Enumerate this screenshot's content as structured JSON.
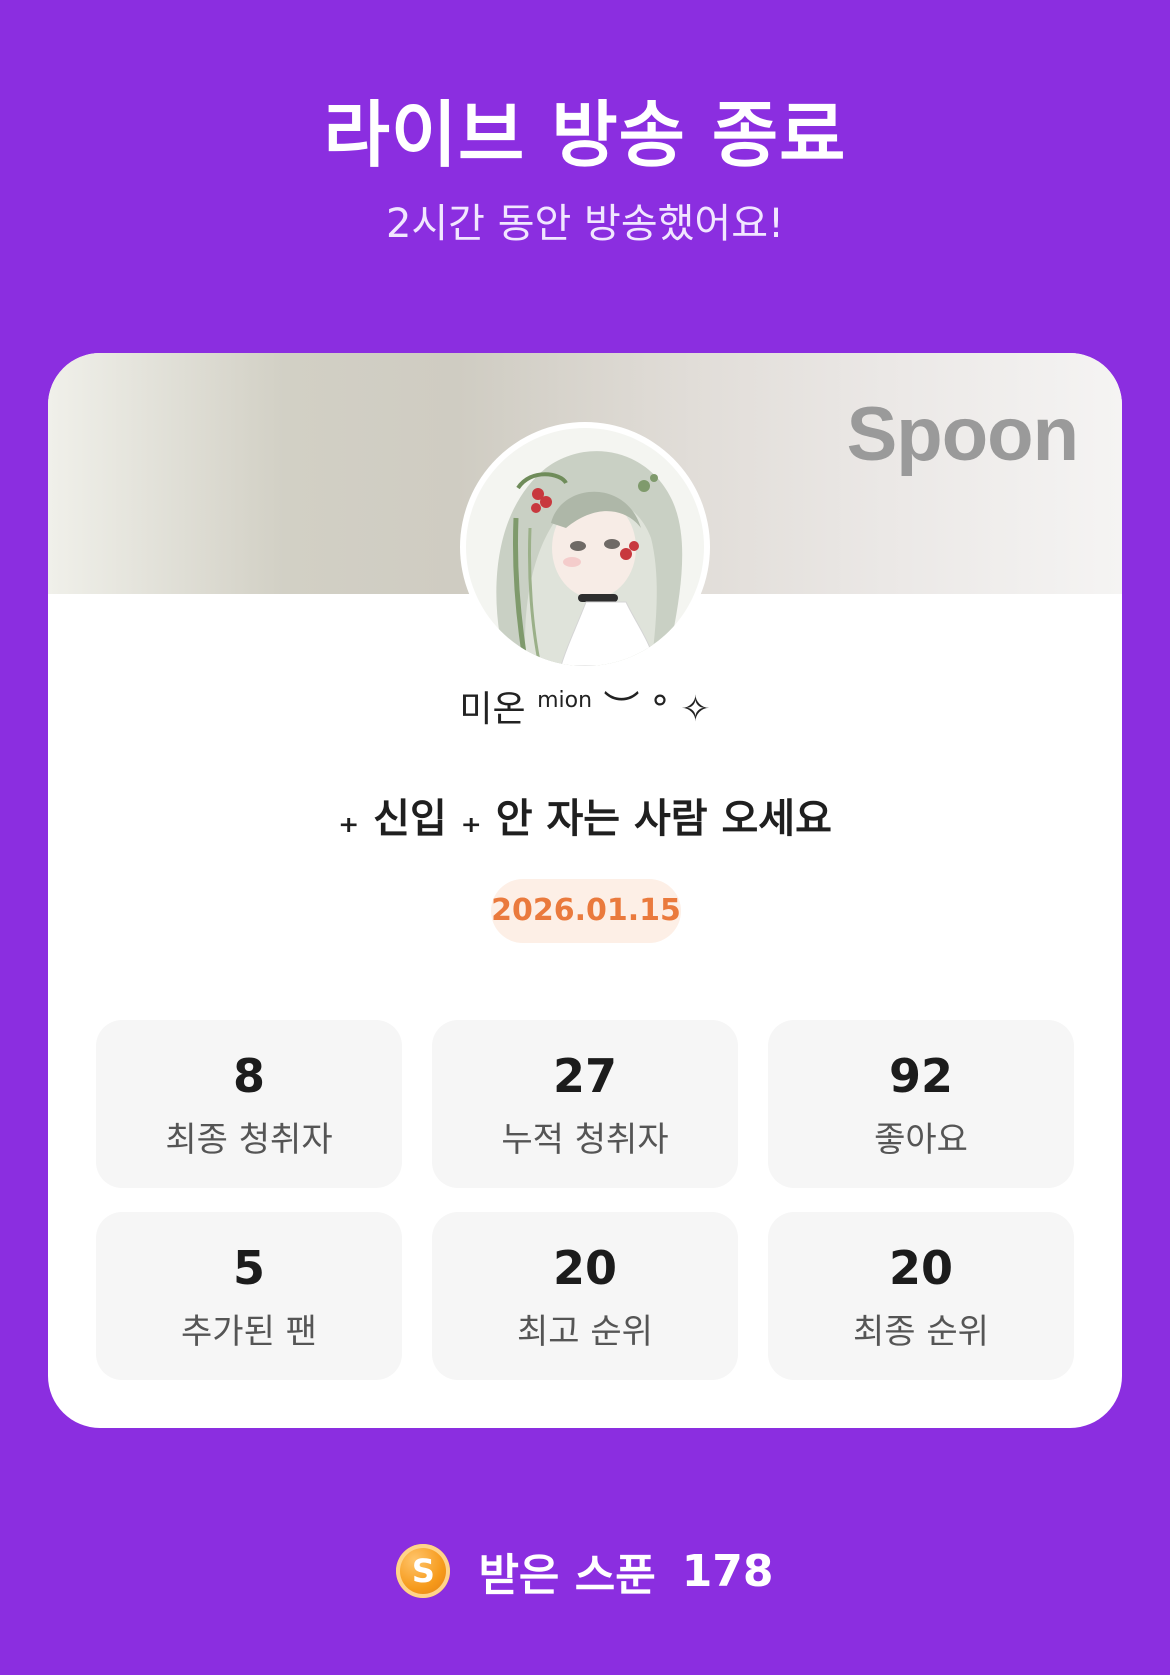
{
  "header": {
    "title": "라이브 방송 종료",
    "subtitle": "2시간 동안 방송했어요!"
  },
  "card": {
    "brand": "Spoon",
    "nickname": {
      "main": "미온",
      "superscript": "mion",
      "decoration": "︶ ° ✧"
    },
    "live_title": "₊ 신입 ₊ 안 자는 사람 오세요",
    "date": "2026.01.15",
    "stats": [
      {
        "value": "8",
        "label": "최종 청취자"
      },
      {
        "value": "27",
        "label": "누적 청취자"
      },
      {
        "value": "92",
        "label": "좋아요"
      },
      {
        "value": "5",
        "label": "추가된 팬"
      },
      {
        "value": "20",
        "label": "최고 순위"
      },
      {
        "value": "20",
        "label": "최종 순위"
      }
    ]
  },
  "footer": {
    "coin_letter": "S",
    "label": "받은 스푼",
    "value": "178"
  },
  "colors": {
    "background": "#8b2ee0",
    "date_text": "#ea7a3d",
    "date_badge": "#fdefe6",
    "stat_tile": "#f6f6f6"
  }
}
